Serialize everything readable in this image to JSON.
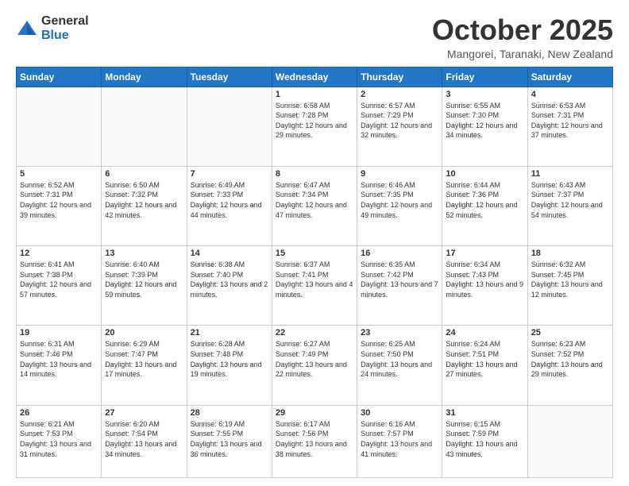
{
  "logo": {
    "general": "General",
    "blue": "Blue"
  },
  "title": "October 2025",
  "location": "Mangorei, Taranaki, New Zealand",
  "days_of_week": [
    "Sunday",
    "Monday",
    "Tuesday",
    "Wednesday",
    "Thursday",
    "Friday",
    "Saturday"
  ],
  "weeks": [
    [
      {
        "day": "",
        "info": ""
      },
      {
        "day": "",
        "info": ""
      },
      {
        "day": "",
        "info": ""
      },
      {
        "day": "1",
        "info": "Sunrise: 6:58 AM\nSunset: 7:28 PM\nDaylight: 12 hours and 29 minutes."
      },
      {
        "day": "2",
        "info": "Sunrise: 6:57 AM\nSunset: 7:29 PM\nDaylight: 12 hours and 32 minutes."
      },
      {
        "day": "3",
        "info": "Sunrise: 6:55 AM\nSunset: 7:30 PM\nDaylight: 12 hours and 34 minutes."
      },
      {
        "day": "4",
        "info": "Sunrise: 6:53 AM\nSunset: 7:31 PM\nDaylight: 12 hours and 37 minutes."
      }
    ],
    [
      {
        "day": "5",
        "info": "Sunrise: 6:52 AM\nSunset: 7:31 PM\nDaylight: 12 hours and 39 minutes."
      },
      {
        "day": "6",
        "info": "Sunrise: 6:50 AM\nSunset: 7:32 PM\nDaylight: 12 hours and 42 minutes."
      },
      {
        "day": "7",
        "info": "Sunrise: 6:49 AM\nSunset: 7:33 PM\nDaylight: 12 hours and 44 minutes."
      },
      {
        "day": "8",
        "info": "Sunrise: 6:47 AM\nSunset: 7:34 PM\nDaylight: 12 hours and 47 minutes."
      },
      {
        "day": "9",
        "info": "Sunrise: 6:46 AM\nSunset: 7:35 PM\nDaylight: 12 hours and 49 minutes."
      },
      {
        "day": "10",
        "info": "Sunrise: 6:44 AM\nSunset: 7:36 PM\nDaylight: 12 hours and 52 minutes."
      },
      {
        "day": "11",
        "info": "Sunrise: 6:43 AM\nSunset: 7:37 PM\nDaylight: 12 hours and 54 minutes."
      }
    ],
    [
      {
        "day": "12",
        "info": "Sunrise: 6:41 AM\nSunset: 7:38 PM\nDaylight: 12 hours and 57 minutes."
      },
      {
        "day": "13",
        "info": "Sunrise: 6:40 AM\nSunset: 7:39 PM\nDaylight: 12 hours and 59 minutes."
      },
      {
        "day": "14",
        "info": "Sunrise: 6:38 AM\nSunset: 7:40 PM\nDaylight: 13 hours and 2 minutes."
      },
      {
        "day": "15",
        "info": "Sunrise: 6:37 AM\nSunset: 7:41 PM\nDaylight: 13 hours and 4 minutes."
      },
      {
        "day": "16",
        "info": "Sunrise: 6:35 AM\nSunset: 7:42 PM\nDaylight: 13 hours and 7 minutes."
      },
      {
        "day": "17",
        "info": "Sunrise: 6:34 AM\nSunset: 7:43 PM\nDaylight: 13 hours and 9 minutes."
      },
      {
        "day": "18",
        "info": "Sunrise: 6:32 AM\nSunset: 7:45 PM\nDaylight: 13 hours and 12 minutes."
      }
    ],
    [
      {
        "day": "19",
        "info": "Sunrise: 6:31 AM\nSunset: 7:46 PM\nDaylight: 13 hours and 14 minutes."
      },
      {
        "day": "20",
        "info": "Sunrise: 6:29 AM\nSunset: 7:47 PM\nDaylight: 13 hours and 17 minutes."
      },
      {
        "day": "21",
        "info": "Sunrise: 6:28 AM\nSunset: 7:48 PM\nDaylight: 13 hours and 19 minutes."
      },
      {
        "day": "22",
        "info": "Sunrise: 6:27 AM\nSunset: 7:49 PM\nDaylight: 13 hours and 22 minutes."
      },
      {
        "day": "23",
        "info": "Sunrise: 6:25 AM\nSunset: 7:50 PM\nDaylight: 13 hours and 24 minutes."
      },
      {
        "day": "24",
        "info": "Sunrise: 6:24 AM\nSunset: 7:51 PM\nDaylight: 13 hours and 27 minutes."
      },
      {
        "day": "25",
        "info": "Sunrise: 6:23 AM\nSunset: 7:52 PM\nDaylight: 13 hours and 29 minutes."
      }
    ],
    [
      {
        "day": "26",
        "info": "Sunrise: 6:21 AM\nSunset: 7:53 PM\nDaylight: 13 hours and 31 minutes."
      },
      {
        "day": "27",
        "info": "Sunrise: 6:20 AM\nSunset: 7:54 PM\nDaylight: 13 hours and 34 minutes."
      },
      {
        "day": "28",
        "info": "Sunrise: 6:19 AM\nSunset: 7:55 PM\nDaylight: 13 hours and 36 minutes."
      },
      {
        "day": "29",
        "info": "Sunrise: 6:17 AM\nSunset: 7:56 PM\nDaylight: 13 hours and 38 minutes."
      },
      {
        "day": "30",
        "info": "Sunrise: 6:16 AM\nSunset: 7:57 PM\nDaylight: 13 hours and 41 minutes."
      },
      {
        "day": "31",
        "info": "Sunrise: 6:15 AM\nSunset: 7:59 PM\nDaylight: 13 hours and 43 minutes."
      },
      {
        "day": "",
        "info": ""
      }
    ]
  ]
}
